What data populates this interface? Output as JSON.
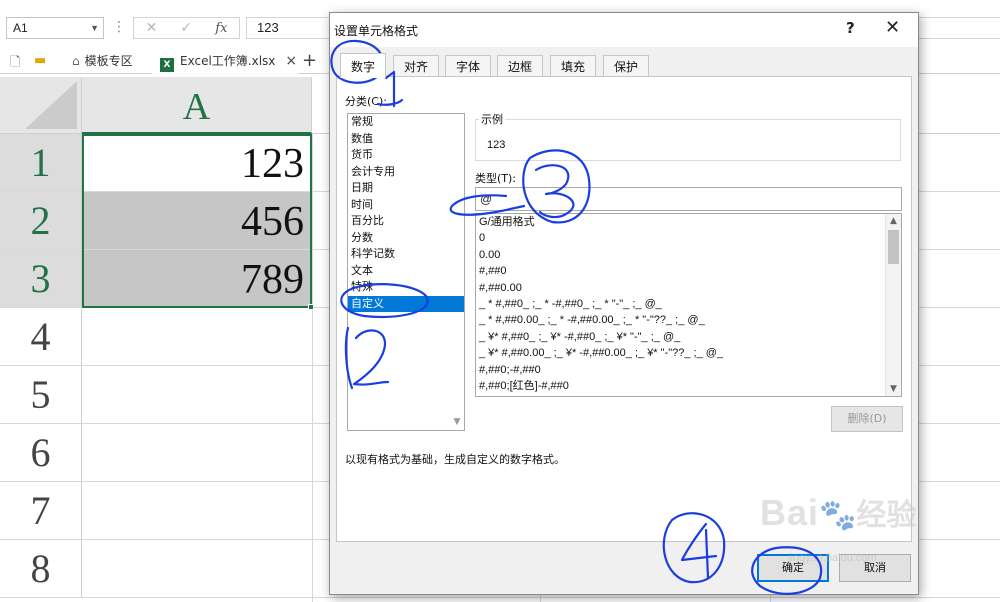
{
  "formula_bar": {
    "name_box": "A1",
    "separator": "⋮",
    "cancel_icon": "✕",
    "enter_icon": "✓",
    "fx_label": "fx",
    "formula": "123"
  },
  "tabs": {
    "template_tab": "模板专区",
    "workbook_tab": "Excel工作簿.xlsx",
    "xl_badge": "X",
    "close": "×",
    "add": "+"
  },
  "sheet": {
    "column_header": "A",
    "row_numbers": [
      "1",
      "2",
      "3",
      "4",
      "5",
      "6",
      "7",
      "8"
    ],
    "cells": [
      "123",
      "456",
      "789"
    ]
  },
  "dialog": {
    "title": "设置单元格格式",
    "help": "?",
    "close": "✕",
    "tabs": [
      "数字",
      "对齐",
      "字体",
      "边框",
      "填充",
      "保护"
    ],
    "category_label": "分类(C):",
    "categories": [
      "常规",
      "数值",
      "货币",
      "会计专用",
      "日期",
      "时间",
      "百分比",
      "分数",
      "科学记数",
      "文本",
      "特殊",
      "自定义"
    ],
    "selected_category": "自定义",
    "sample_label": "示例",
    "sample_value": "123",
    "type_label": "类型(T):",
    "type_value": "@",
    "formats": [
      "G/通用格式",
      "0",
      "0.00",
      "#,##0",
      "#,##0.00",
      "_ * #,##0_ ;_ * -#,##0_ ;_ * \"-\"_ ;_ @_",
      "_ * #,##0.00_ ;_ * -#,##0.00_ ;_ * \"-\"??_ ;_ @_",
      "_ ¥* #,##0_ ;_ ¥* -#,##0_ ;_ ¥* \"-\"_ ;_ @_",
      "_ ¥* #,##0.00_ ;_ ¥* -#,##0.00_ ;_ ¥* \"-\"??_ ;_ @_",
      "#,##0;-#,##0",
      "#,##0;[红色]-#,##0"
    ],
    "delete_button": "删除(D)",
    "description": "以现有格式为基础，生成自定义的数字格式。",
    "ok_button": "确定",
    "cancel_button": "取消"
  },
  "watermark": {
    "brand": "Bai",
    "paw": "🐾",
    "brand2": "经验",
    "url": "jingyan.baidu.com"
  },
  "annotations": {
    "step1": "1",
    "step2": "2",
    "step3": "3",
    "step4": "4",
    "color": "#1a3ee0"
  },
  "colors": {
    "excel_green": "#217346",
    "selection_blue": "#0078d7"
  }
}
